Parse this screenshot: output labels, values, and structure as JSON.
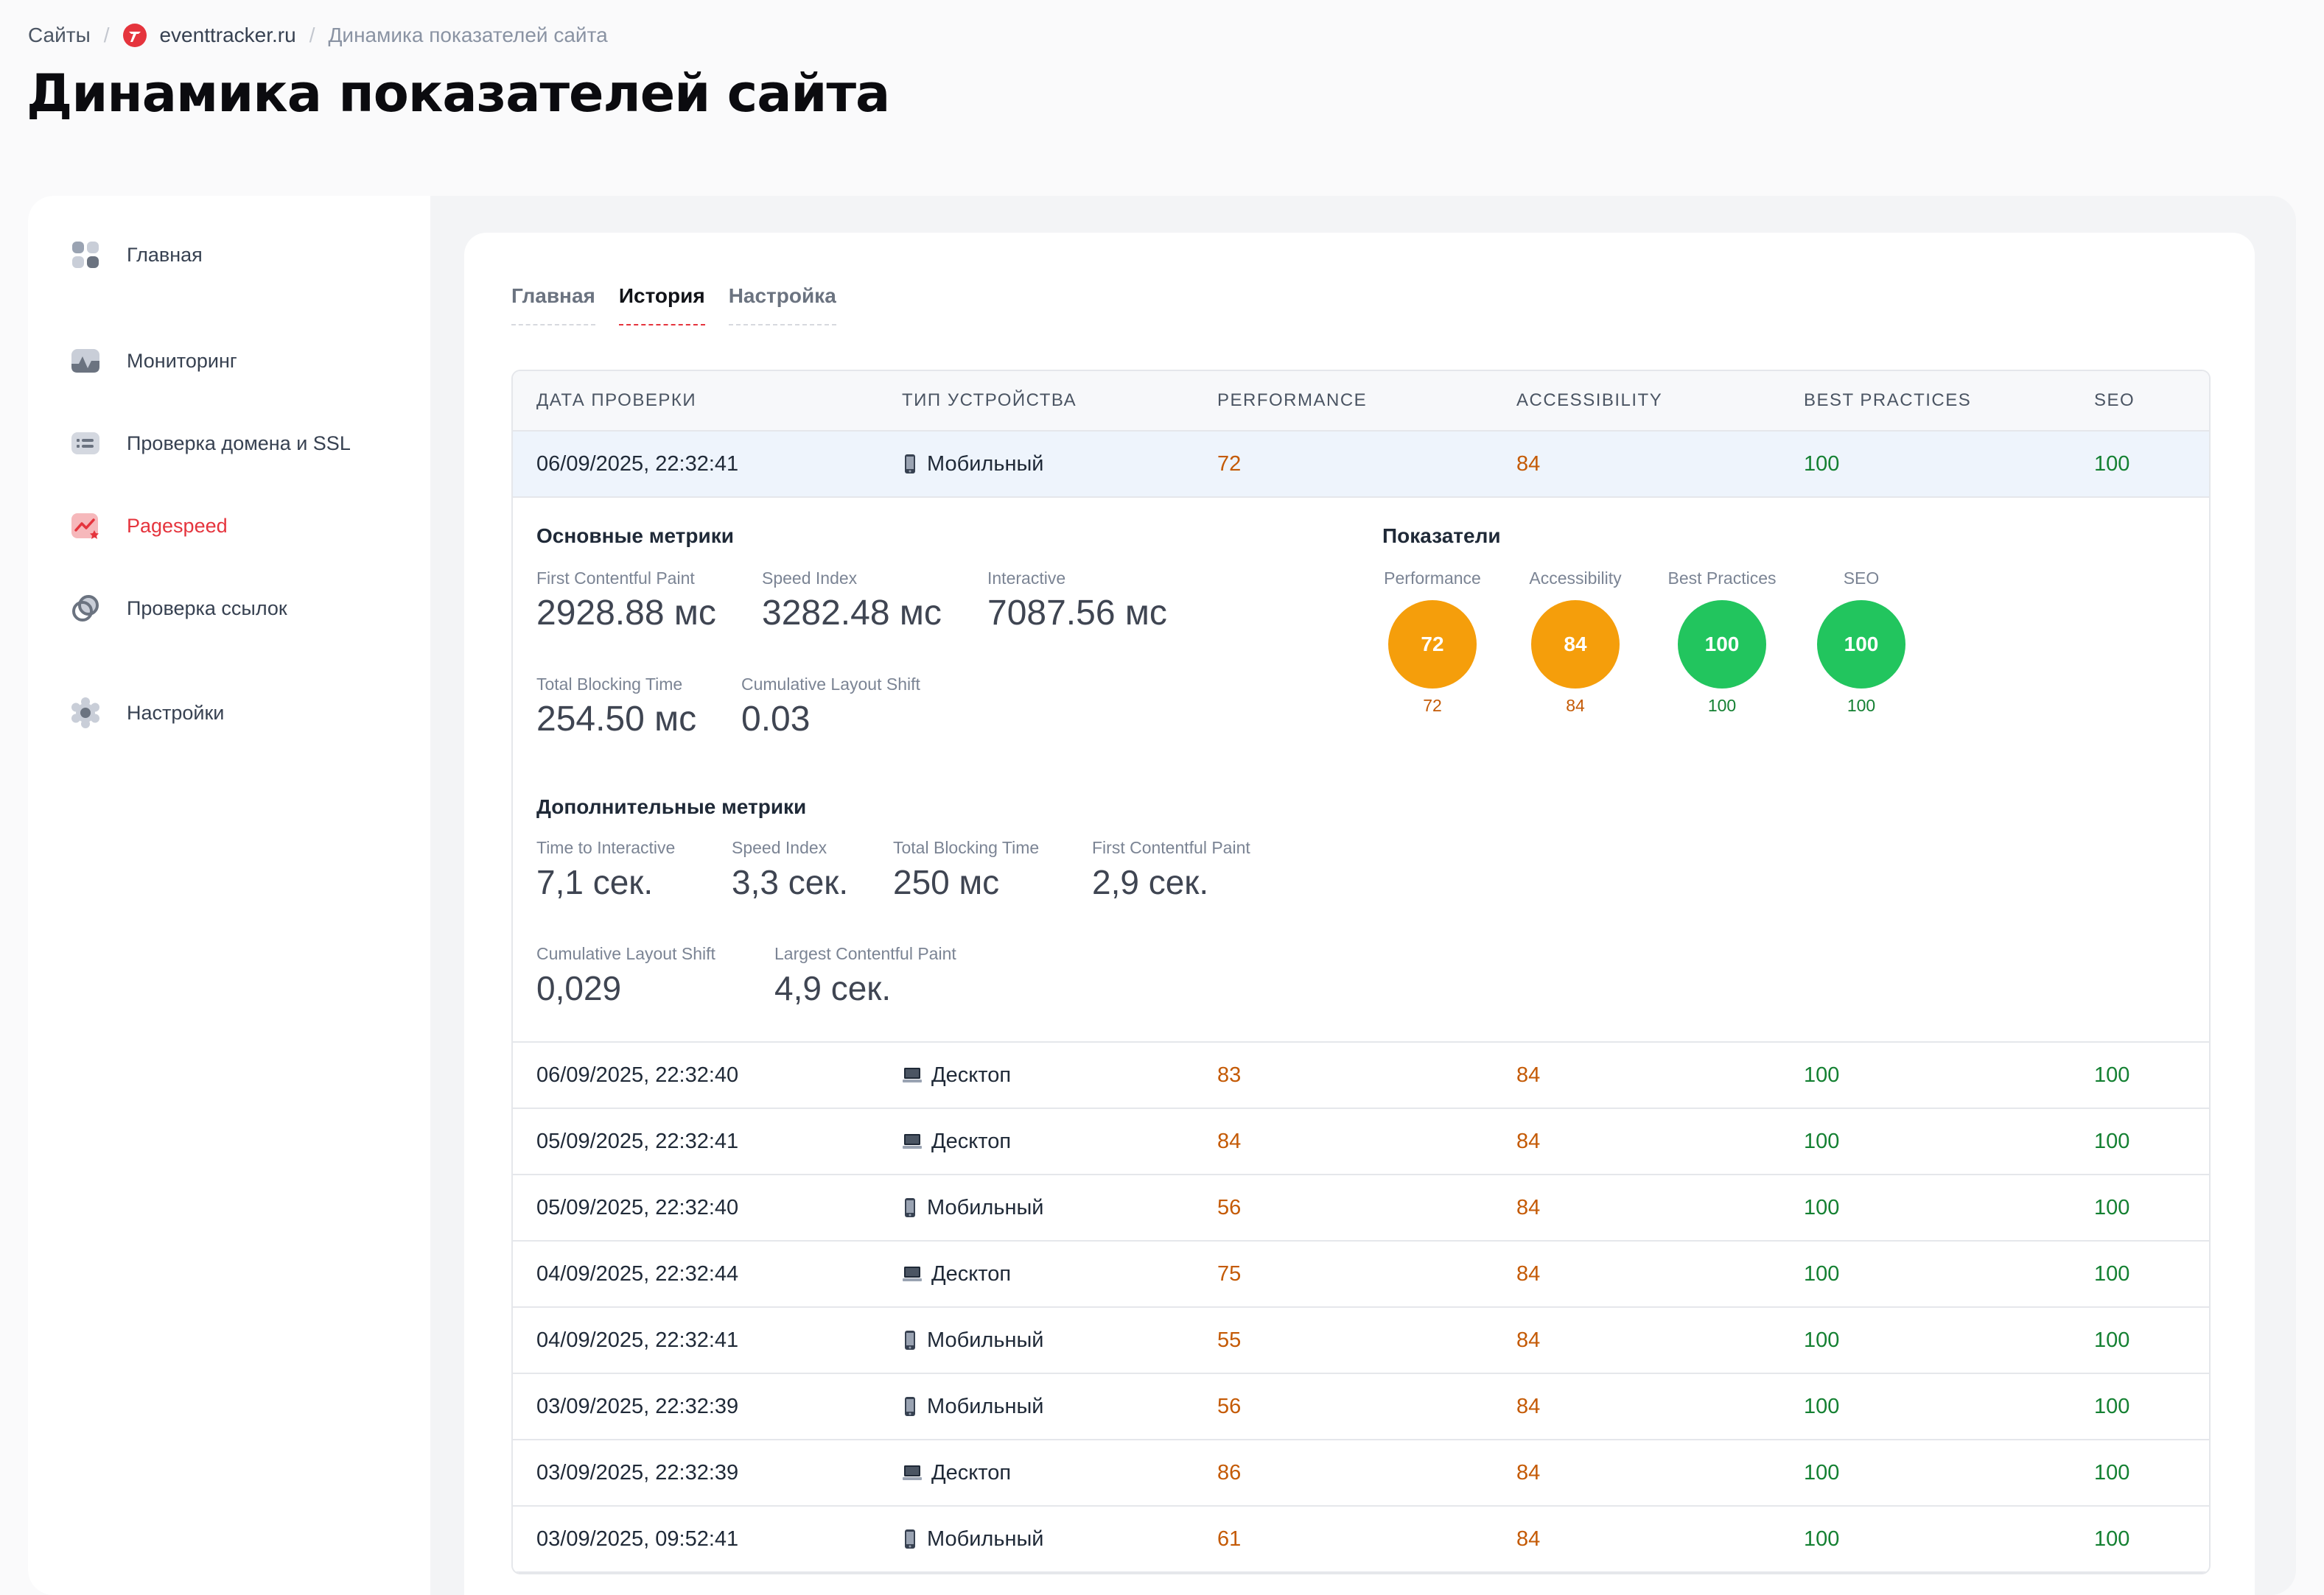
{
  "breadcrumb": {
    "root": "Сайты",
    "site": "eventtracker.ru",
    "current": "Динамика показателей сайта"
  },
  "page_title": "Динамика показателей сайта",
  "sidebar": {
    "items": [
      {
        "label": "Главная",
        "icon": "dashboard-icon"
      },
      {
        "label": "Мониторинг",
        "icon": "monitoring-icon"
      },
      {
        "label": "Проверка домена и SSL",
        "icon": "domain-ssl-icon"
      },
      {
        "label": "Pagespeed",
        "icon": "pagespeed-icon",
        "active": true
      },
      {
        "label": "Проверка ссылок",
        "icon": "links-icon"
      },
      {
        "label": "Настройки",
        "icon": "gear-icon"
      }
    ]
  },
  "tabs": [
    {
      "label": "Главная"
    },
    {
      "label": "История",
      "active": true
    },
    {
      "label": "Настройка"
    }
  ],
  "table": {
    "headers": [
      "ДАТА ПРОВЕРКИ",
      "ТИП УСТРОЙСТВА",
      "PERFORMANCE",
      "ACCESSIBILITY",
      "BEST PRACTICES",
      "SEO"
    ],
    "selected_row": {
      "date": "06/09/2025, 22:32:41",
      "device": "Мобильный",
      "performance": "72",
      "accessibility": "84",
      "best_practices": "100",
      "seo": "100"
    },
    "rows": [
      {
        "date": "06/09/2025, 22:32:40",
        "device": "Десктоп",
        "performance": "83",
        "accessibility": "84",
        "best_practices": "100",
        "seo": "100"
      },
      {
        "date": "05/09/2025, 22:32:41",
        "device": "Десктоп",
        "performance": "84",
        "accessibility": "84",
        "best_practices": "100",
        "seo": "100"
      },
      {
        "date": "05/09/2025, 22:32:40",
        "device": "Мобильный",
        "performance": "56",
        "accessibility": "84",
        "best_practices": "100",
        "seo": "100"
      },
      {
        "date": "04/09/2025, 22:32:44",
        "device": "Десктоп",
        "performance": "75",
        "accessibility": "84",
        "best_practices": "100",
        "seo": "100"
      },
      {
        "date": "04/09/2025, 22:32:41",
        "device": "Мобильный",
        "performance": "55",
        "accessibility": "84",
        "best_practices": "100",
        "seo": "100"
      },
      {
        "date": "03/09/2025, 22:32:39",
        "device": "Мобильный",
        "performance": "56",
        "accessibility": "84",
        "best_practices": "100",
        "seo": "100"
      },
      {
        "date": "03/09/2025, 22:32:39",
        "device": "Десктоп",
        "performance": "86",
        "accessibility": "84",
        "best_practices": "100",
        "seo": "100"
      },
      {
        "date": "03/09/2025, 09:52:41",
        "device": "Мобильный",
        "performance": "61",
        "accessibility": "84",
        "best_practices": "100",
        "seo": "100"
      }
    ]
  },
  "details": {
    "main_title": "Основные метрики",
    "main_metrics": [
      {
        "label": "First Contentful Paint",
        "value": "2928.88 мс"
      },
      {
        "label": "Speed Index",
        "value": "3282.48 мс"
      },
      {
        "label": "Interactive",
        "value": "7087.56 мс"
      },
      {
        "label": "Total Blocking Time",
        "value": "254.50 мс"
      },
      {
        "label": "Cumulative Layout Shift",
        "value": "0.03"
      }
    ],
    "scores_title": "Показатели",
    "scores": [
      {
        "label": "Performance",
        "value": "72",
        "status": "orange"
      },
      {
        "label": "Accessibility",
        "value": "84",
        "status": "orange"
      },
      {
        "label": "Best Practices",
        "value": "100",
        "status": "green"
      },
      {
        "label": "SEO",
        "value": "100",
        "status": "green"
      }
    ],
    "extra_title": "Дополнительные метрики",
    "extra_metrics": [
      {
        "label": "Time to Interactive",
        "value": "7,1 сек."
      },
      {
        "label": "Speed Index",
        "value": "3,3 сек."
      },
      {
        "label": "Total Blocking Time",
        "value": "250 мс"
      },
      {
        "label": "First Contentful Paint",
        "value": "2,9 сек."
      },
      {
        "label": "Cumulative Layout Shift",
        "value": "0,029"
      },
      {
        "label": "Largest Contentful Paint",
        "value": "4,9 сек."
      }
    ]
  },
  "colors": {
    "accent_red": "#e5343d",
    "score_orange": "#f59e0b",
    "score_green": "#22c55e",
    "text_orange": "#c45a05",
    "text_green": "#148032",
    "selected_row_bg": "#eef4fc"
  }
}
